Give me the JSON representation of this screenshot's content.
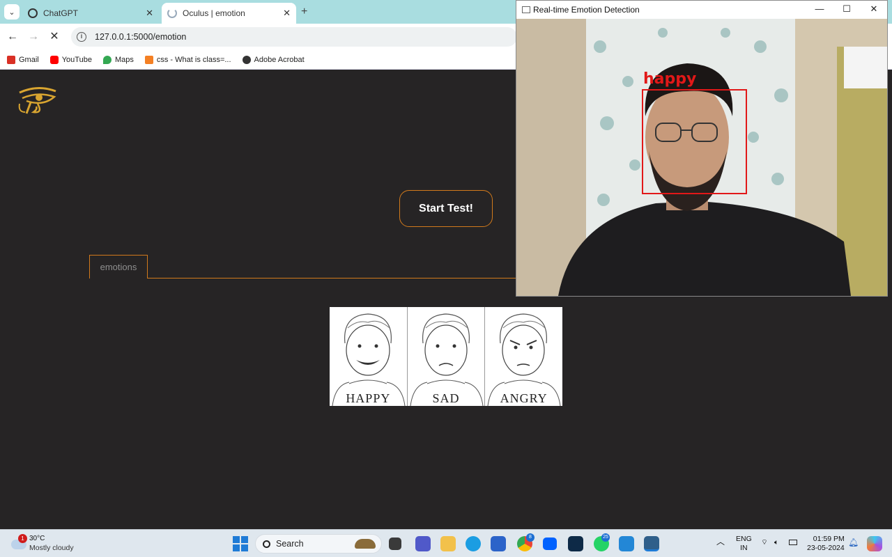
{
  "browser": {
    "tabs": [
      {
        "title": "ChatGPT",
        "active": false
      },
      {
        "title": "Oculus | emotion",
        "active": true
      }
    ],
    "url": "127.0.0.1:5000/emotion",
    "bookmarks": [
      {
        "label": "Gmail",
        "color": "#d93025"
      },
      {
        "label": "YouTube",
        "color": "#ff0000"
      },
      {
        "label": "Maps",
        "color": "#34a853"
      },
      {
        "label": "css - What is class=...",
        "color": "#f48024"
      },
      {
        "label": "Adobe Acrobat",
        "color": "#333333"
      }
    ]
  },
  "page": {
    "start_button": "Start Test!",
    "tab_label": "emotions",
    "faces": [
      {
        "label": "HAPPY",
        "mood": "happy"
      },
      {
        "label": "SAD",
        "mood": "sad"
      },
      {
        "label": "ANGRY",
        "mood": "angry"
      }
    ],
    "accent_color": "#d27a1c"
  },
  "detector_window": {
    "title": "Real-time Emotion Detection",
    "detected_emotion": "happy",
    "box_color": "#e11818"
  },
  "taskbar": {
    "weather": {
      "notification_count": "1",
      "temp": "30°C",
      "desc": "Mostly cloudy"
    },
    "search_placeholder": "Search",
    "apps": [
      {
        "name": "file-manager-icon"
      },
      {
        "name": "teams-icon"
      },
      {
        "name": "file-explorer-icon"
      },
      {
        "name": "edge-icon"
      },
      {
        "name": "store-icon"
      },
      {
        "name": "chrome-icon",
        "badge": "8"
      },
      {
        "name": "dropbox-icon"
      },
      {
        "name": "app-icon"
      },
      {
        "name": "whatsapp-icon",
        "badge": "25"
      },
      {
        "name": "vscode-icon"
      },
      {
        "name": "python-icon"
      }
    ],
    "language": {
      "line1": "ENG",
      "line2": "IN"
    },
    "time": "01:59 PM",
    "date": "23-05-2024"
  }
}
